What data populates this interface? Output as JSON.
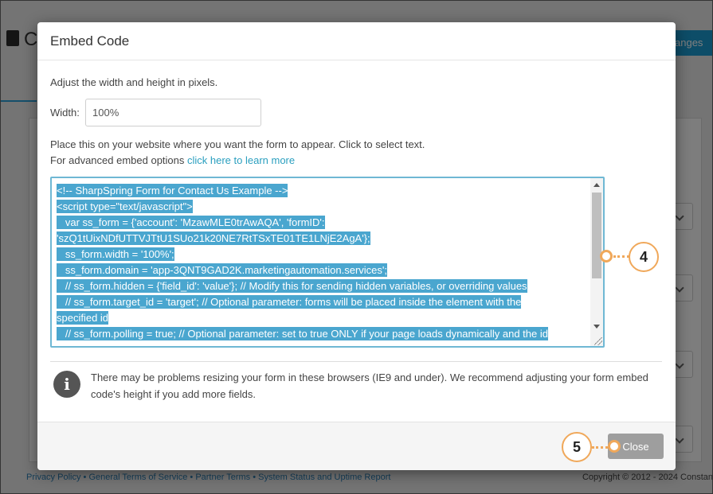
{
  "background": {
    "header_letter": "C",
    "changes_button": "anges",
    "footer_links": [
      "Privacy Policy",
      "General Terms of Service",
      "Partner Terms",
      "System Status and Uptime Report"
    ],
    "copyright": "Copyright © 2012 - 2024 Constan"
  },
  "modal": {
    "title": "Embed Code",
    "size_instruction": "Adjust the width and height in pixels.",
    "width_label": "Width:",
    "width_value": "100%",
    "place_instruction": "Place this on your website where you want the form to appear. Click to select text.",
    "advanced_prefix": "For advanced embed options ",
    "advanced_link": "click here to learn more",
    "code_lines": [
      "<!-- SharpSpring Form for Contact Us Example  -->",
      "<script type=\"text/javascript\">",
      "   var ss_form = {'account': 'MzawMLE0trAwAQA', 'formID':",
      "'szQ1tUixNDfUTTVJTtU1SUo21k20NE7RtTSxTE01TE1LNjE2AgA'};",
      "   ss_form.width = '100%';",
      "   ss_form.domain = 'app-3QNT9GAD2K.marketingautomation.services';",
      "   // ss_form.hidden = {'field_id': 'value'}; // Modify this for sending hidden variables, or overriding values",
      "   // ss_form.target_id = 'target'; // Optional parameter: forms will be placed inside the element with the",
      "specified id",
      "   // ss_form.polling = true; // Optional parameter: set to true ONLY if your page loads dynamically and the id"
    ],
    "info_text": "There may be problems resizing your form in these browsers (IE9 and under). We recommend adjusting your form embed code's height if you add more fields.",
    "close_label": "Close"
  },
  "callouts": {
    "four": "4",
    "five": "5",
    "color": "#f0a85a"
  }
}
